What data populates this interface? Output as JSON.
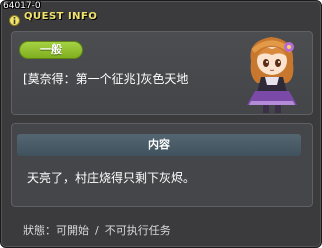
{
  "window": {
    "quest_id": "64017-0",
    "title": "QUEST INFO",
    "title_icon": "info-icon"
  },
  "quest": {
    "category": "一般",
    "name": "[莫奈得：第一个征兆]灰色天地",
    "npc_portrait": "npc-portrait"
  },
  "content": {
    "header": "内容",
    "text": "天亮了，村庄烧得只剩下灰烬。"
  },
  "status": {
    "label": "狀態：",
    "value": "可開始",
    "separator": "/",
    "availability": "不可执行任务"
  },
  "colors": {
    "window_bg": "#3b3b3d",
    "title": "#f1e46a",
    "category_pill": "#8fbc2b",
    "content_header": "#4a5d69"
  }
}
